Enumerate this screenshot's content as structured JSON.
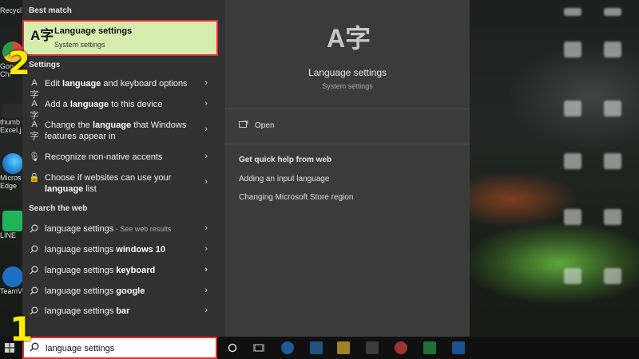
{
  "desktop": {
    "icons": [
      {
        "label": "Recycl",
        "color": "#7a8a99"
      },
      {
        "label": "Goo\nChr",
        "color": "#d9453a"
      },
      {
        "label": "thumb\nExcel.j",
        "color": "#3a3a3a"
      },
      {
        "label": "Micros\nEdge",
        "color": "#1f7fd0"
      },
      {
        "label": "LINE",
        "color": "#21b35a"
      },
      {
        "label": "TeamVie",
        "color": "#1e6fc4"
      }
    ]
  },
  "search_results": {
    "best_match_header": "Best match",
    "best_match": {
      "title": "Language settings",
      "subtitle": "System settings",
      "icon": "A字"
    },
    "settings_header": "Settings",
    "settings_items": [
      {
        "pre": "Edit ",
        "bold": "language",
        "post": " and keyboard options",
        "icon": "language-icon",
        "glyph": "A字"
      },
      {
        "pre": "Add a ",
        "bold": "language",
        "post": " to this device",
        "icon": "language-icon",
        "glyph": "A字"
      },
      {
        "pre": "Change the ",
        "bold": "language",
        "post": " that Windows features appear in",
        "icon": "language-icon",
        "glyph": "A字"
      },
      {
        "pre": "Recognize non-native accents",
        "bold": "",
        "post": "",
        "icon": "microphone-icon",
        "glyph": "🎙"
      },
      {
        "pre": "Choose if websites can use your ",
        "bold": "language",
        "post": " list",
        "icon": "lock-icon",
        "glyph": "🔒"
      }
    ],
    "web_header": "Search the web",
    "web_items": [
      {
        "pre": "language settings",
        "bold": "",
        "hint": " - See web results"
      },
      {
        "pre": "language settings ",
        "bold": "windows 10",
        "hint": ""
      },
      {
        "pre": "language settings ",
        "bold": "keyboard",
        "hint": ""
      },
      {
        "pre": "language settings ",
        "bold": "google",
        "hint": ""
      },
      {
        "pre": "language settings ",
        "bold": "bar",
        "hint": ""
      }
    ]
  },
  "detail": {
    "icon": "A字",
    "title": "Language settings",
    "subtitle": "System settings",
    "open_label": "Open",
    "help_header": "Get quick help from web",
    "help_links": [
      "Adding an input language",
      "Changing Microsoft Store region"
    ]
  },
  "search": {
    "value": "language settings"
  },
  "annotations": {
    "step1": "1",
    "step2": "2"
  },
  "colors": {
    "highlight": "#d6edae",
    "annotation_border": "#e03030",
    "annotation_number": "#ffea00"
  }
}
